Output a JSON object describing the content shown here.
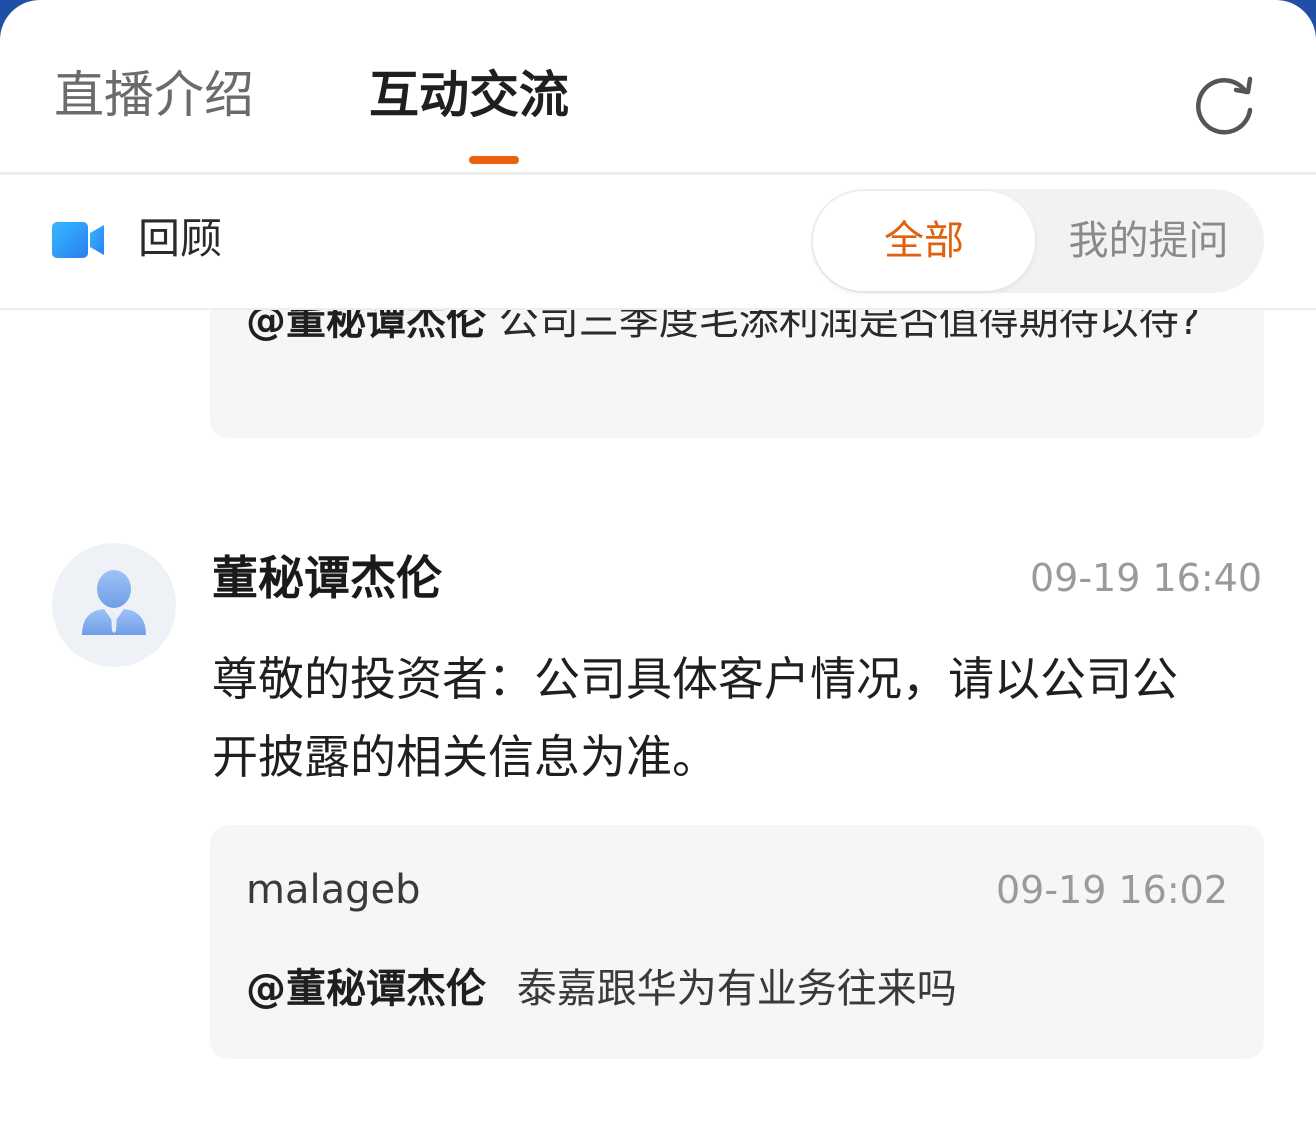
{
  "tabs": {
    "intro_label": "直播介绍",
    "interact_label": "互动交流",
    "accent_color": "#e8620f"
  },
  "filter": {
    "review_label": "回顾",
    "all_label": "全部",
    "mine_label": "我的提问"
  },
  "feed": {
    "top_quote": {
      "mention": "@董秘谭杰伦",
      "text": "公司三季度毛添利润是否值得期待以待?"
    },
    "reply": {
      "author": "董秘谭杰伦",
      "time": "09-19 16:40",
      "text": "尊敬的投资者：公司具体客户情况，请以公司公开披露的相关信息为准。",
      "quote": {
        "user": "malageb",
        "time": "09-19 16:02",
        "mention": "@董秘谭杰伦",
        "text": "泰嘉跟华为有业务往来吗"
      }
    }
  },
  "icons": {
    "refresh": "refresh-icon",
    "video": "video-camera-icon",
    "avatar": "user-avatar-icon"
  }
}
